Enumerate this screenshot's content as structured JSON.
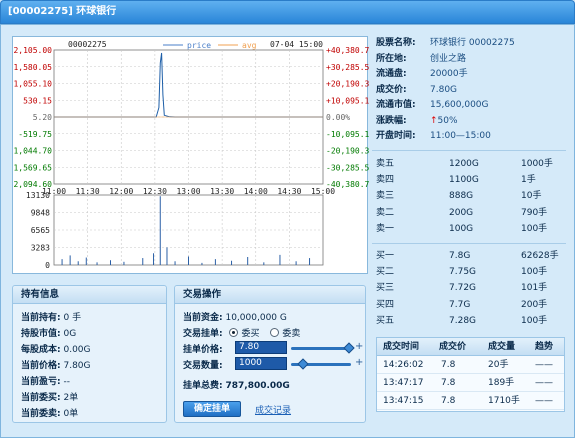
{
  "window": {
    "title": "[00002275] 环球银行"
  },
  "chart_data": {
    "type": "line",
    "stock_code": "00002275",
    "legend": [
      {
        "name": "price",
        "color": "#4a7fc8"
      },
      {
        "name": "avg",
        "color": "#f0a050"
      }
    ],
    "timestamp": "07-04 15:00",
    "left_ticks": [
      "2,105.00",
      "1,580.05",
      "1,055.10",
      "530.15",
      "5.20",
      "-519.75",
      "-1,044.70",
      "-1,569.65",
      "-2,094.60"
    ],
    "right_ticks": [
      "+40,380.7",
      "+30,285.5",
      "+20,190.3",
      "+10,095.1",
      "0.00%",
      "-10,095.1",
      "-20,190.3",
      "-30,285.5",
      "-40,380.7"
    ],
    "time_ticks": [
      "11:00",
      "11:30",
      "12:00",
      "12:30",
      "13:00",
      "13:30",
      "14:00",
      "14:30",
      "15:00"
    ],
    "volume_ticks": [
      "13130",
      "9848",
      "6565",
      "3283",
      "0"
    ],
    "price_series": [
      {
        "t": 0.0,
        "v": 5.2
      },
      {
        "t": 0.38,
        "v": 5.2
      },
      {
        "t": 0.39,
        "v": 300
      },
      {
        "t": 0.395,
        "v": 1700
      },
      {
        "t": 0.4,
        "v": 2010
      },
      {
        "t": 0.405,
        "v": 700
      },
      {
        "t": 0.41,
        "v": 60
      },
      {
        "t": 0.43,
        "v": 10
      },
      {
        "t": 0.45,
        "v": 5.2
      },
      {
        "t": 1.0,
        "v": 5.2
      }
    ],
    "volume_series": [
      {
        "t": 0.03,
        "v": 1100
      },
      {
        "t": 0.06,
        "v": 1800
      },
      {
        "t": 0.09,
        "v": 700
      },
      {
        "t": 0.12,
        "v": 1400
      },
      {
        "t": 0.16,
        "v": 500
      },
      {
        "t": 0.21,
        "v": 900
      },
      {
        "t": 0.26,
        "v": 600
      },
      {
        "t": 0.33,
        "v": 1300
      },
      {
        "t": 0.37,
        "v": 2200
      },
      {
        "t": 0.395,
        "v": 12900
      },
      {
        "t": 0.42,
        "v": 3300
      },
      {
        "t": 0.45,
        "v": 700
      },
      {
        "t": 0.5,
        "v": 1600
      },
      {
        "t": 0.55,
        "v": 400
      },
      {
        "t": 0.6,
        "v": 1100
      },
      {
        "t": 0.66,
        "v": 800
      },
      {
        "t": 0.72,
        "v": 1500
      },
      {
        "t": 0.78,
        "v": 500
      },
      {
        "t": 0.84,
        "v": 1900
      },
      {
        "t": 0.9,
        "v": 700
      },
      {
        "t": 0.95,
        "v": 1300
      }
    ]
  },
  "info": {
    "name_label": "股票名称:",
    "name_value": "环球银行 00002275",
    "location_label": "所在地:",
    "location_value": "创业之路",
    "float_label": "流通盘:",
    "float_value": "20000手",
    "price_label": "成交价:",
    "price_value": "7.80G",
    "cap_label": "流通市值:",
    "cap_value": "15,600,000G",
    "change_label": "涨跌幅:",
    "change_arrow": "↑",
    "change_value": "50%",
    "hours_label": "开盘时间:",
    "hours_value": "11:00—15:00"
  },
  "sell_orders": [
    {
      "name": "卖五",
      "price": "1200G",
      "qty": "1000手"
    },
    {
      "name": "卖四",
      "price": "1100G",
      "qty": "1手"
    },
    {
      "name": "卖三",
      "price": "888G",
      "qty": "10手"
    },
    {
      "name": "卖二",
      "price": "200G",
      "qty": "790手"
    },
    {
      "name": "卖一",
      "price": "100G",
      "qty": "100手"
    }
  ],
  "buy_orders": [
    {
      "name": "买一",
      "price": "7.8G",
      "qty": "62628手"
    },
    {
      "name": "买二",
      "price": "7.75G",
      "qty": "100手"
    },
    {
      "name": "买三",
      "price": "7.72G",
      "qty": "101手"
    },
    {
      "name": "买四",
      "price": "7.7G",
      "qty": "200手"
    },
    {
      "name": "买五",
      "price": "7.28G",
      "qty": "100手"
    }
  ],
  "holdings": {
    "title": "持有信息",
    "rows": [
      {
        "k": "当前持有:",
        "v": "0 手"
      },
      {
        "k": "持股市值:",
        "v": "0G"
      },
      {
        "k": "每股成本:",
        "v": "0.00G"
      },
      {
        "k": "当前价格:",
        "v": "7.80G"
      },
      {
        "k": "当前盈亏:",
        "v": "--"
      },
      {
        "k": "当前委买:",
        "v": "2单"
      },
      {
        "k": "当前委卖:",
        "v": "0单"
      }
    ]
  },
  "trade": {
    "title": "交易操作",
    "funds_label": "当前资金:",
    "funds_value": "10,000,000 G",
    "order_label": "交易挂单:",
    "buy_label": "委买",
    "sell_label": "委卖",
    "price_label": "挂单价格:",
    "price_value": "7.80",
    "qty_label": "交易数量:",
    "qty_value": "1000",
    "total_label": "挂单总费:",
    "total_value": "787,800.00G",
    "confirm_label": "确定挂单",
    "record_label": "成交记录"
  },
  "deals": {
    "headers": [
      "成交时间",
      "成交价",
      "成交量",
      "趋势"
    ],
    "rows": [
      {
        "time": "14:26:02",
        "price": "7.8",
        "qty": "20手",
        "trend": "——"
      },
      {
        "time": "13:47:17",
        "price": "7.8",
        "qty": "189手",
        "trend": "——"
      },
      {
        "time": "13:47:15",
        "price": "7.8",
        "qty": "1710手",
        "trend": "——"
      }
    ]
  }
}
